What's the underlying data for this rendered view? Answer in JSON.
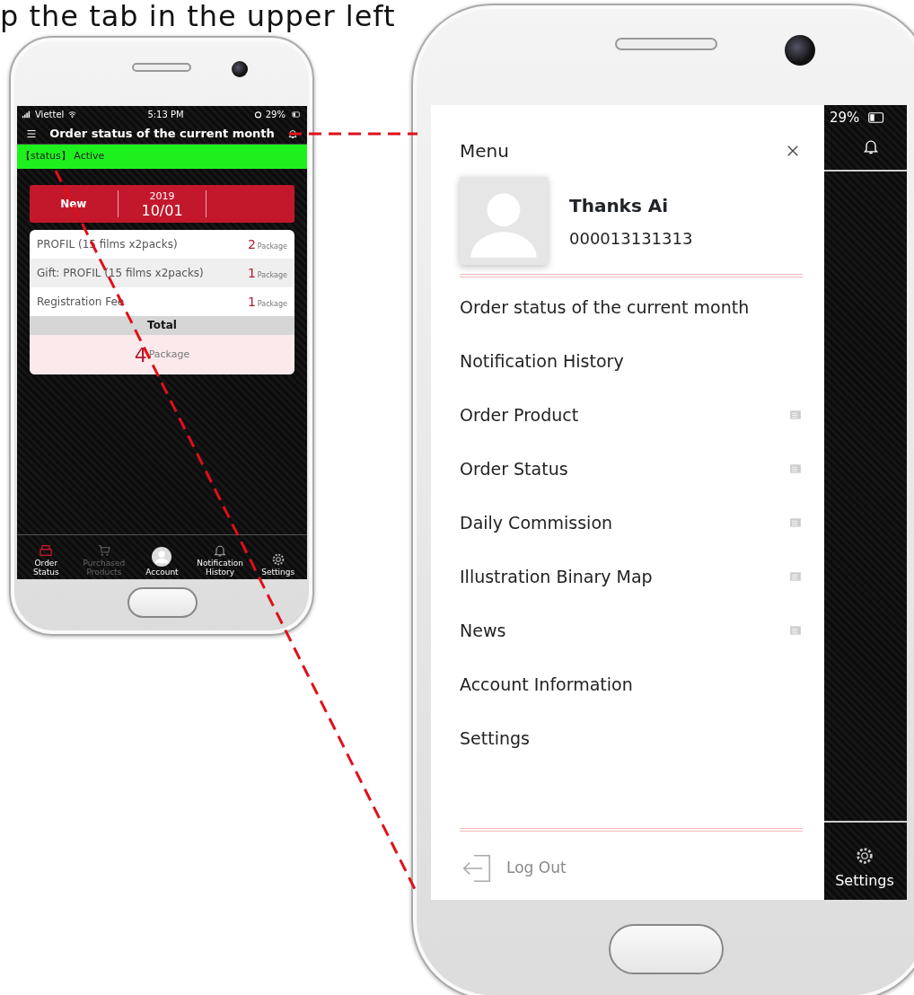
{
  "caption": "p the tab in the upper left",
  "small_phone": {
    "status_bar": {
      "carrier": "Viettel",
      "time": "5:13 PM",
      "battery": "29%"
    },
    "header": {
      "title": "Order status of the current month"
    },
    "status_banner": "【status】 Active",
    "date_bar": {
      "label": "New",
      "year": "2019",
      "date": "10/01"
    },
    "order_items": [
      {
        "name": "PROFIL (15 films x2packs)",
        "count": "2",
        "unit": "Package"
      },
      {
        "name": "Gift: PROFIL (15 films x2packs)",
        "count": "1",
        "unit": "Package"
      },
      {
        "name": "Registration Fee",
        "count": "1",
        "unit": "Package"
      }
    ],
    "total": {
      "label": "Total",
      "count": "4",
      "unit": "Package"
    },
    "tab_bar": [
      {
        "label": "Order Status",
        "selected": true,
        "disabled": false
      },
      {
        "label": "Purchased Products",
        "selected": false,
        "disabled": true
      },
      {
        "label": "Account",
        "selected": false,
        "disabled": false
      },
      {
        "label": "Notification History",
        "selected": false,
        "disabled": false
      },
      {
        "label": "Settings",
        "selected": false,
        "disabled": false
      }
    ]
  },
  "large_phone": {
    "status_bar": {
      "battery": "29%"
    },
    "drawer": {
      "title": "Menu",
      "profile": {
        "name": "Thanks Ai",
        "member_id": "000013131313"
      },
      "menu_items": [
        {
          "label": "Order status of the current month",
          "has_icon": false
        },
        {
          "label": "Notification History",
          "has_icon": false
        },
        {
          "label": "Order Product",
          "has_icon": true
        },
        {
          "label": "Order Status",
          "has_icon": true
        },
        {
          "label": "Daily Commission",
          "has_icon": true
        },
        {
          "label": "Illustration Binary Map",
          "has_icon": true
        },
        {
          "label": "News",
          "has_icon": true
        },
        {
          "label": "Account Information",
          "has_icon": false
        },
        {
          "label": "Settings",
          "has_icon": false
        }
      ],
      "logout": "Log Out"
    },
    "tab_bar_visible": {
      "label": "Settings"
    }
  }
}
